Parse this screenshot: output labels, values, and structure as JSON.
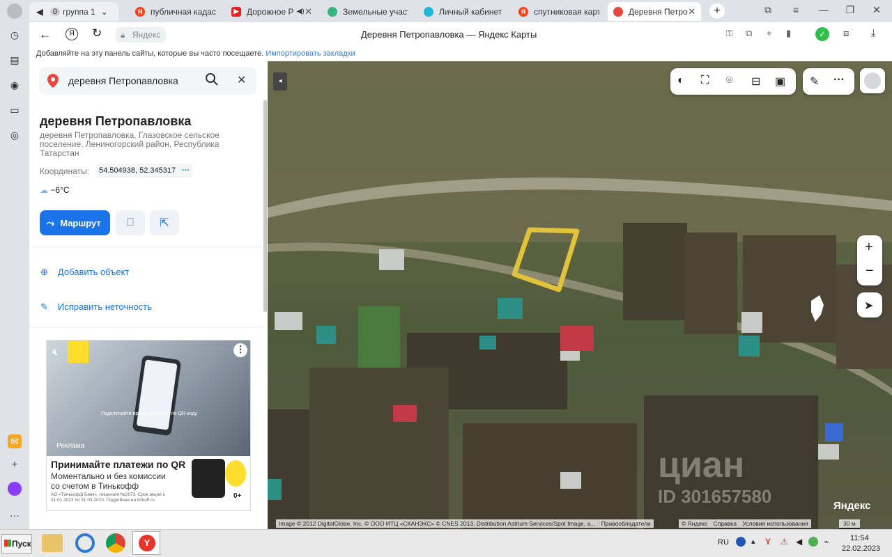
{
  "tabs": [
    {
      "label": "группа 1",
      "badge": "0",
      "color": "#9e9e9e"
    },
    {
      "label": "публичная кадаст",
      "color": "#fc3f1d"
    },
    {
      "label": "Дорожное Р",
      "color": "#e52222"
    },
    {
      "label": "Земельные участ",
      "color": "#36b37e"
    },
    {
      "label": "Личный кабинет -",
      "color": "#1fb9d5"
    },
    {
      "label": "спутниковая карт",
      "color": "#fc3f1d"
    },
    {
      "label": "Деревня Петро",
      "color": "#e7473c"
    }
  ],
  "address": {
    "host": "Яндекс",
    "title": "Деревня Петропавловка — Яндекс Карты"
  },
  "bookmarks": {
    "text": "Добавляйте на эту панель сайты, которые вы часто посещаете.",
    "link": "Импортировать закладки"
  },
  "search": {
    "value": "деревня Петропавловка"
  },
  "place": {
    "title": "деревня Петропавловка",
    "address": "деревня Петропавловка, Глазовское сельское поселение, Лениногорский район, Республика Татарстан",
    "coords_label": "Координаты:",
    "coords": "54.504938, 52.345317",
    "weather": "−6°C"
  },
  "actions": {
    "route": "Маршрут",
    "add_object": "Добавить объект",
    "fix": "Исправить неточность"
  },
  "ad": {
    "label": "Реклама",
    "caption": "Подключайте приём платежей по QR-коду",
    "headline": "Принимайте платежи по QR",
    "body": "Моментально и без комиссии со счетом в Тинькофф",
    "legal": "АО «Тинькофф Банк», лицензия №2673. Срок акции с 31.01.2023 по 31.03.2023. Подробнее на tinkoff.ru",
    "age": "0+"
  },
  "map": {
    "copyright": "Image © 2012 DigitalGlobe, Inc. © ООО ИТЦ «СКАНЭКС» © CNES 2013, Distribution Astrium Services/Spot Image, a...",
    "rights": "Правообладатели",
    "yandex": "© Яндекс",
    "help": "Справка",
    "terms": "Условия использования",
    "scale": "30 м",
    "logo": "Яндекс",
    "watermark": "циан",
    "watermark_id": "ID 301657580"
  },
  "taskbar": {
    "start": "Пуск",
    "lang": "RU",
    "time": "11:54",
    "date": "22.02.2023"
  },
  "colors": {
    "accent": "#1a73e8",
    "plot": "#e2c23a"
  }
}
